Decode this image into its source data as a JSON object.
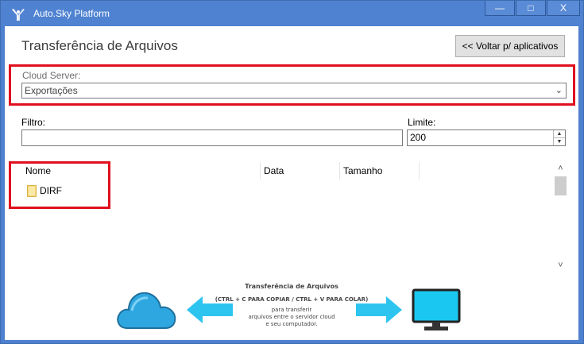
{
  "window": {
    "title": "Auto.Sky Platform",
    "controls": {
      "minimize": "—",
      "maximize": "□",
      "close": "X"
    },
    "colors": {
      "titlebar": "#4f82d1",
      "highlight": "#e0101e",
      "cloud": "#2ea7e0",
      "arrow": "#2ec4f0"
    }
  },
  "header": {
    "title": "Transferência de Arquivos",
    "back_button": "<< Voltar p/ aplicativos"
  },
  "cloud_server": {
    "label": "Cloud Server:",
    "selected": "Exportações"
  },
  "filter": {
    "label": "Filtro:",
    "value": ""
  },
  "limit": {
    "label": "Limite:",
    "value": "200"
  },
  "file_list": {
    "columns": [
      "Nome",
      "Data",
      "Tamanho"
    ],
    "rows": [
      {
        "name": "DIRF",
        "date": "",
        "size": "",
        "icon": "folder-icon"
      }
    ]
  },
  "banner": {
    "title": "Transferência de Arquivos",
    "line2": "(CTRL + C PARA COPIAR / CTRL + V PARA COLAR)",
    "line3": "para transferir",
    "line4": "arquivos entre o servidor cloud",
    "line5": "e seu computador."
  }
}
